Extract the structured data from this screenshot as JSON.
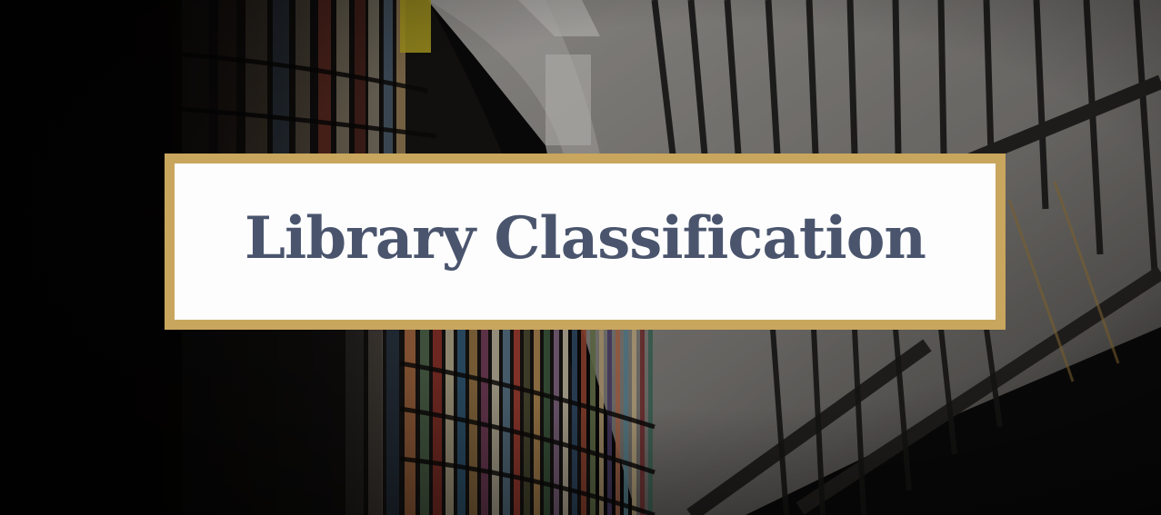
{
  "slide": {
    "title": "Library Classification"
  },
  "background": {
    "icon": "library-bookshelves-photo"
  },
  "colors": {
    "frame_border": "#c9a65e",
    "frame_fill": "#fdfdfe",
    "title_text": "#4a556d",
    "backdrop": "#0b0a0a"
  }
}
